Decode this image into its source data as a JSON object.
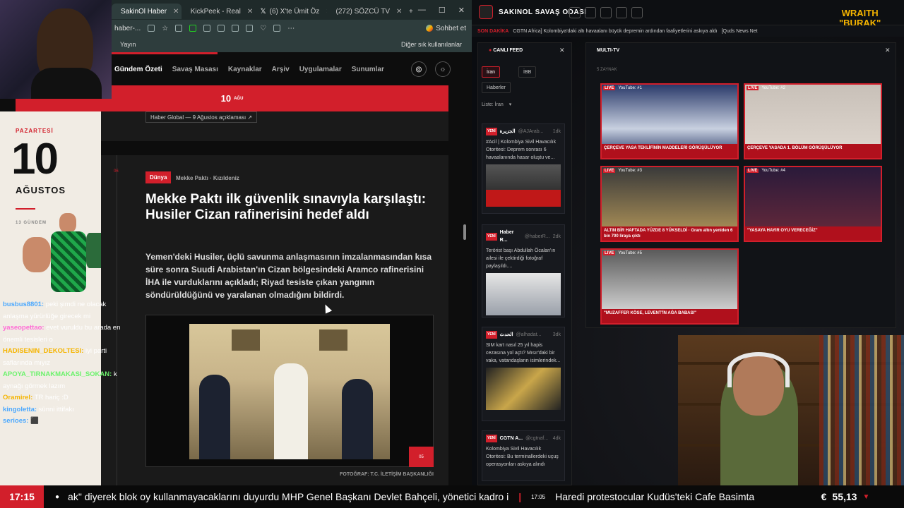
{
  "browser": {
    "tabs": [
      {
        "label": "SakinOl Haber",
        "color": "#d21f2b"
      },
      {
        "label": "KickPeek - Real",
        "color": "#2aa5d8"
      },
      {
        "label": "(6) X'te Ümit Öz",
        "color": "#ffffff"
      },
      {
        "label": "(272) SÖZCÜ TV",
        "color": "#e62117"
      }
    ],
    "new_tab": "+",
    "address": "haber-...",
    "chat_label": "Sohbet et",
    "bookmark_left": "Yayın",
    "bookmark_right": "Diğer sık kullanılanlar"
  },
  "site": {
    "nav": [
      "Gündem Özeti",
      "Savaş Masası",
      "Kaynaklar",
      "Arşiv",
      "Uygulamalar",
      "Sunumlar"
    ],
    "date_number": "10",
    "date_small": "AĞU",
    "day_name": "PAZARTESİ",
    "big_day": "10",
    "month": "AĞUSTOS",
    "gundem_count": "13 GÜNDEM",
    "prev_tag": "Haber Global — 9 Ağustos açıklaması ↗",
    "article_num": "06",
    "category": "Dünya",
    "subcategory": "Mekke Paktı · Kızıldeniz",
    "headline": "Mekke Paktı ilk güvenlik sınavıyla karşılaştı: Husiler Cizan rafinerisini hedef aldı",
    "lead": "Yemen'deki Husiler, üçlü savunma anlaşmasının imzalanmasından kısa süre sonra Suudi Arabistan'ın Cizan bölgesindeki Aramco rafinerisini İHA ile vurduklarını açıkladı; Riyad tesiste çıkan yangının söndürüldüğünü ve yaralanan olmadığını bildirdi.",
    "photo_badge": "05",
    "caption": "FOTOĞRAF: T.C. İLETİŞİM BAŞKANLIĞI"
  },
  "chat": [
    {
      "user": "busbus8801:",
      "text": "peki şimdi ne olacak anlaşma yürürlüğe girecek mi",
      "color": "#4aa8ff"
    },
    {
      "user": "yaseopettao:",
      "text": "evet vuruldu bu arada en önemli tesisleri o",
      "color": "#ff6bd6"
    },
    {
      "user": "HADISENIN_DEKOLTESI:",
      "text": "iyi parti saflarında mıyız",
      "color": "#f5b400"
    },
    {
      "user": "APOYA_TIRNAKMAKASI_SOKAN:",
      "text": "k aynağı görmek lazım",
      "color": "#6cf26c"
    },
    {
      "user": "Oramirel:",
      "text": "TR hariç :D",
      "color": "#f5b400"
    },
    {
      "user": "kingoletta:",
      "text": "sünni ittifakı",
      "color": "#4aa8ff"
    },
    {
      "user": "serioes:",
      "text": "⬛",
      "color": "#4aa8ff"
    }
  ],
  "dashboard": {
    "title": "SAKINOL SAVAŞ ODASI",
    "brand_line1": "WRAITH",
    "brand_line2": "\"BURAK\"",
    "ticker_label": "SON DAKİKA",
    "ticker_text": "CGTN Africa] Kolombiya'daki altı havaalanı büyük depremin ardından faaliyetlerini askıya aldı",
    "ticker_more": "[Quds News Net",
    "feed_title": "CANLI FEED",
    "feed_tabs": [
      "İran",
      "İBB",
      "Haberler"
    ],
    "feed_list_label": "Liste: İran",
    "feed_cards": [
      {
        "new": "YENİ",
        "name": "الجزيرة",
        "handle": "@AJArab...",
        "time": "1dk",
        "text": "#Acil | Kolombiya Sivil Havacılık Otoritesi: Deprem sonrası 6 havaalanında hasar oluştu ve..."
      },
      {
        "new": "YENİ",
        "name": "Haber R...",
        "handle": "@haberR...",
        "time": "2dk",
        "text": "Terörist başı Abdullah Öcalan'ın ailesi ile çektirdiği fotoğraf paylaşıldı...."
      },
      {
        "new": "YENİ",
        "name": "الحدث",
        "handle": "@alhadat...",
        "time": "3dk",
        "text": "SIM kart nasıl 25 yıl hapis cezasına yol açtı? Mısır'daki bir vaka, vatandaşların isimlerindek..."
      },
      {
        "new": "YENİ",
        "name": "CGTN A...",
        "handle": "@cgtnaf...",
        "time": "4dk",
        "text": "Kolombiya Sivil Havacılık Otoritesi: Bu terminallerdeki uçuş operasyonları askıya alındı"
      }
    ],
    "multi_title": "MULTI-TV",
    "multi_zoom": "5 ZAYNAK",
    "tiles": [
      {
        "live": "LIVE",
        "label": "YouTube: #1",
        "banner": "ÇERÇEVE YASA TEKLİFİNİN MADDELERİ GÖRÜŞÜLÜYOR"
      },
      {
        "live": "LIVE",
        "label": "YouTube: #2",
        "banner": "ÇERÇEVE YASADA 1. BÖLÜM GÖRÜŞÜLÜYOR"
      },
      {
        "live": "LIVE",
        "label": "YouTube: #3",
        "banner": "ALTIN BİR HAFTADA YÜZDE 8 YÜKSELDİ · Gram altın yeniden 6 bin 700 liraya çıktı"
      },
      {
        "live": "LIVE",
        "label": "YouTube: #4",
        "banner": "\"YASAYA HAYIR OYU VERECEĞİZ\""
      },
      {
        "live": "LIVE",
        "label": "YouTube: #5",
        "banner": "\"MUZAFFER KÖSE, LEVENT'İN AĞA BABASI\""
      }
    ]
  },
  "bottom": {
    "time": "17:15",
    "ticker1": "ak\" diyerek blok oy kullanmayacaklarını duyurdu MHP Genel Başkanı Devlet Bahçeli, yönetici kadro i",
    "ticker2_time": "17:05",
    "ticker2": "Haredi protestocular Kudüs'teki Cafe Basimta",
    "euro_symbol": "€",
    "euro_value": "55,13",
    "euro_arrow": "▼"
  },
  "colors": {
    "accent": "#d21f2b",
    "brand_gold": "#f5b400"
  }
}
